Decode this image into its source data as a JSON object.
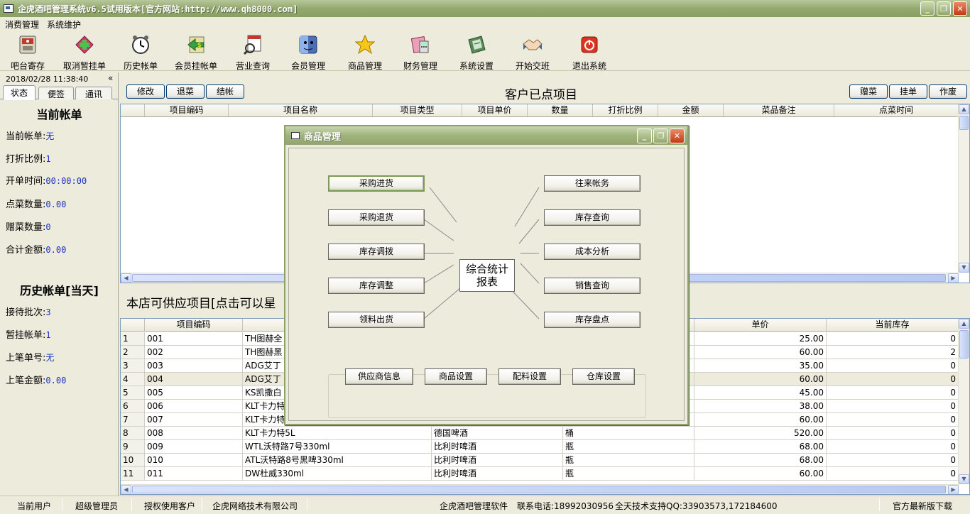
{
  "window": {
    "title": "企虎酒吧管理系统v6.5试用版本[官方网站:http://www.qh8000.com]",
    "minimize": "_",
    "maximize": "❐",
    "close": "✕"
  },
  "menubar": [
    "消费管理",
    "系统维护"
  ],
  "toolbar": [
    {
      "label": "吧台寄存",
      "icon": "safe-icon"
    },
    {
      "label": "取消暂挂单",
      "icon": "cancel-hold-icon"
    },
    {
      "label": "历史帐单",
      "icon": "alarm-clock-icon"
    },
    {
      "label": "会员挂帐单",
      "icon": "member-credit-icon"
    },
    {
      "label": "营业查询",
      "icon": "business-query-icon"
    },
    {
      "label": "会员管理",
      "icon": "member-icon"
    },
    {
      "label": "商品管理",
      "icon": "star-icon"
    },
    {
      "label": "财务管理",
      "icon": "finance-icon"
    },
    {
      "label": "系统设置",
      "icon": "settings-icon"
    },
    {
      "label": "开始交班",
      "icon": "handshake-icon"
    },
    {
      "label": "退出系统",
      "icon": "power-icon"
    }
  ],
  "left_panel": {
    "datetime": "2018/02/28 11:38:40",
    "collapse": "«",
    "tabs": [
      "状态",
      "便签",
      "通讯"
    ],
    "current_bill": {
      "heading": "当前帐单",
      "rows": [
        {
          "label": "当前帐单:",
          "value": "无"
        },
        {
          "label": "打折比例:",
          "value": "1"
        },
        {
          "label": "开单时间:",
          "value": "00:00:00"
        },
        {
          "label": "点菜数量:",
          "value": "0.00"
        },
        {
          "label": "赠菜数量:",
          "value": "0"
        },
        {
          "label": "合计金额:",
          "value": "0.00"
        }
      ]
    },
    "history": {
      "heading": "历史帐单[当天]",
      "rows": [
        {
          "label": "接待批次:",
          "value": "3"
        },
        {
          "label": "暂挂帐单:",
          "value": "1"
        },
        {
          "label": "上笔单号:",
          "value": "无"
        },
        {
          "label": "上笔金额:",
          "value": "0.00"
        }
      ]
    }
  },
  "ordered": {
    "title": "客户已点项目",
    "left_buttons": [
      "修改",
      "退菜",
      "结帐"
    ],
    "right_buttons": [
      "赠菜",
      "挂单",
      "作废"
    ],
    "columns": [
      "项目编码",
      "项目名称",
      "项目类型",
      "项目单价",
      "数量",
      "打折比例",
      "金额",
      "菜品备注",
      "点菜时间"
    ]
  },
  "supply": {
    "title": "本店可供应项目[点击可以星",
    "columns": [
      "项目编码",
      "单价",
      "当前库存"
    ],
    "rows": [
      {
        "no": "1",
        "code": "001",
        "name": "TH图赫全",
        "type": "",
        "unit": "",
        "price": "25.00",
        "stock": "0"
      },
      {
        "no": "2",
        "code": "002",
        "name": "TH图赫黑",
        "type": "",
        "unit": "",
        "price": "60.00",
        "stock": "2"
      },
      {
        "no": "3",
        "code": "003",
        "name": "ADG艾丁",
        "type": "",
        "unit": "",
        "price": "35.00",
        "stock": "0"
      },
      {
        "no": "4",
        "code": "004",
        "name": "ADG艾丁",
        "type": "",
        "unit": "",
        "price": "60.00",
        "stock": "0"
      },
      {
        "no": "5",
        "code": "005",
        "name": "KS凯撒白",
        "type": "",
        "unit": "",
        "price": "45.00",
        "stock": "0"
      },
      {
        "no": "6",
        "code": "006",
        "name": "KLT卡力特",
        "type": "",
        "unit": "",
        "price": "38.00",
        "stock": "0"
      },
      {
        "no": "7",
        "code": "007",
        "name": "KLT卡力特",
        "type": "",
        "unit": "",
        "price": "60.00",
        "stock": "0"
      },
      {
        "no": "8",
        "code": "008",
        "name": "KLT卡力特5L",
        "type": "德国啤酒",
        "unit": "桶",
        "price": "520.00",
        "stock": "0"
      },
      {
        "no": "9",
        "code": "009",
        "name": "WTL沃特路7号330ml",
        "type": "比利时啤酒",
        "unit": "瓶",
        "price": "68.00",
        "stock": "0"
      },
      {
        "no": "10",
        "code": "010",
        "name": "ATL沃特路8号黑啤330ml",
        "type": "比利时啤酒",
        "unit": "瓶",
        "price": "68.00",
        "stock": "0"
      },
      {
        "no": "11",
        "code": "011",
        "name": "DW杜威330ml",
        "type": "比利时啤酒",
        "unit": "瓶",
        "price": "60.00",
        "stock": "0"
      }
    ]
  },
  "dialog": {
    "title": "商品管理",
    "left_buttons": [
      "采购进货",
      "采购退货",
      "库存调拨",
      "库存调整",
      "领料出货"
    ],
    "right_buttons": [
      "往来帐务",
      "库存查询",
      "成本分析",
      "销售查询",
      "库存盘点"
    ],
    "center": [
      "综合统计",
      "报表"
    ],
    "bottom_buttons": [
      "供应商信息",
      "商品设置",
      "配料设置",
      "仓库设置"
    ]
  },
  "statusbar": {
    "user_label": "当前用户",
    "user_value": "超级管理员",
    "license_label": "授权使用客户",
    "license_value": "企虎网络技术有限公司",
    "software": "企虎酒吧管理软件",
    "phone": "联系电话:18992030956",
    "support": "全天技术支持QQ:33903573,172184600",
    "download": "官方最新版下载"
  }
}
